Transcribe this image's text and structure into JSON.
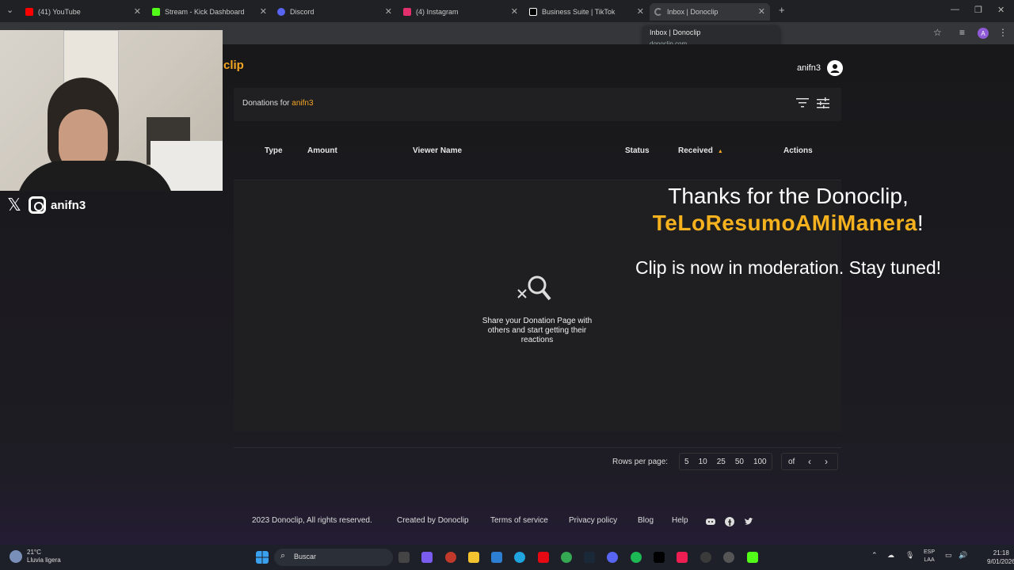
{
  "browser": {
    "tabs": [
      {
        "label": "(41) YouTube",
        "color": "#ff0000"
      },
      {
        "label": "Stream - Kick Dashboard",
        "color": "#53fc18"
      },
      {
        "label": "Discord",
        "color": "#5865f2"
      },
      {
        "label": "(4) Instagram",
        "color": "#e1306c"
      },
      {
        "label": "Business Suite | TikTok",
        "color": "#ffffff"
      },
      {
        "label": "Inbox | Donoclip",
        "color": "#888888"
      }
    ],
    "tooltip": {
      "title": "Inbox | Donoclip",
      "domain": "donoclip.com"
    },
    "profile_initial": "A"
  },
  "site": {
    "brand": "clip",
    "username": "anifn3"
  },
  "panel": {
    "title_prefix": "Donations for",
    "title_user": "anifn3"
  },
  "table": {
    "columns": {
      "type": "Type",
      "amount": "Amount",
      "viewer": "Viewer Name",
      "status": "Status",
      "received": "Received",
      "actions": "Actions"
    },
    "empty_message": "Share your Donation Page with others and start getting their reactions"
  },
  "pagination": {
    "rows_label": "Rows per page:",
    "options": [
      "5",
      "10",
      "25",
      "50",
      "100"
    ],
    "of_label": "of"
  },
  "footer": {
    "copyright": "2023 Donoclip, All rights reserved.",
    "created_by": "Created by Donoclip",
    "terms": "Terms of service",
    "privacy": "Privacy policy",
    "blog": "Blog",
    "help": "Help"
  },
  "alert": {
    "line1": "Thanks for the Donoclip,",
    "donor": "TeLoResumoAMiManera",
    "bang": "!",
    "line3": "Clip is now in moderation. Stay tuned!"
  },
  "overlay": {
    "handle": "anifn3"
  },
  "taskbar": {
    "temp": "21°C",
    "weather": "Lluvia ligera",
    "search_placeholder": "Buscar",
    "lang_top": "ESP",
    "lang_bottom": "LAA",
    "time": "21:18",
    "date": "9/01/2026"
  }
}
